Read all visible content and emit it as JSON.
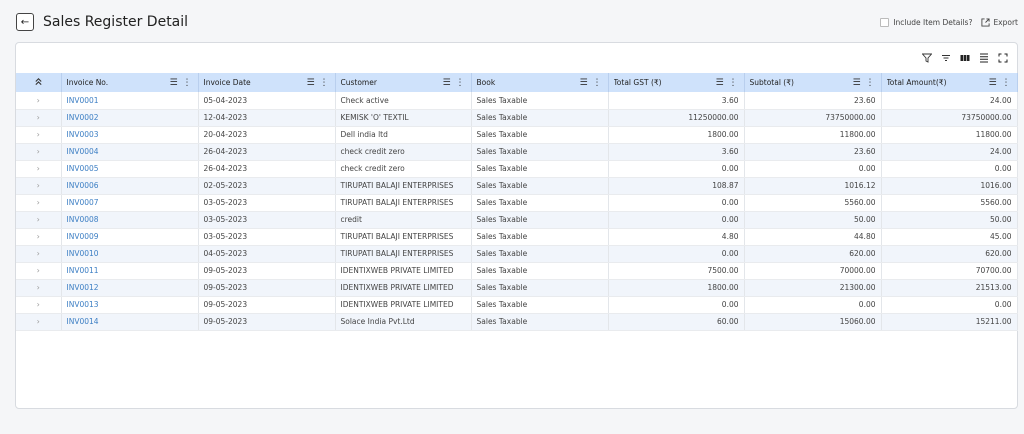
{
  "header": {
    "back_icon": "arrow-left-icon",
    "title": "Sales Register Detail",
    "include_label": "Include Item Details?",
    "export_label": "Export"
  },
  "toolbar": {
    "icons": [
      "filter-icon",
      "sort-icon",
      "columns-icon",
      "density-icon",
      "fullscreen-icon"
    ]
  },
  "table": {
    "columns": [
      "Invoice No.",
      "Invoice Date",
      "Customer",
      "Book",
      "Total GST (₹)",
      "Subtotal (₹)",
      "Total Amount(₹)"
    ],
    "rows": [
      [
        "INV0001",
        "05-04-2023",
        "Check active",
        "Sales Taxable",
        "3.60",
        "23.60",
        "24.00"
      ],
      [
        "INV0002",
        "12-04-2023",
        "KEMISK 'O' TEXTIL",
        "Sales Taxable",
        "11250000.00",
        "73750000.00",
        "73750000.00"
      ],
      [
        "INV0003",
        "20-04-2023",
        "Dell india ltd",
        "Sales Taxable",
        "1800.00",
        "11800.00",
        "11800.00"
      ],
      [
        "INV0004",
        "26-04-2023",
        "check credit zero",
        "Sales Taxable",
        "3.60",
        "23.60",
        "24.00"
      ],
      [
        "INV0005",
        "26-04-2023",
        "check credit zero",
        "Sales Taxable",
        "0.00",
        "0.00",
        "0.00"
      ],
      [
        "INV0006",
        "02-05-2023",
        "TIRUPATI BALAJI ENTERPRISES",
        "Sales Taxable",
        "108.87",
        "1016.12",
        "1016.00"
      ],
      [
        "INV0007",
        "03-05-2023",
        "TIRUPATI BALAJI ENTERPRISES",
        "Sales Taxable",
        "0.00",
        "5560.00",
        "5560.00"
      ],
      [
        "INV0008",
        "03-05-2023",
        "credit",
        "Sales Taxable",
        "0.00",
        "50.00",
        "50.00"
      ],
      [
        "INV0009",
        "03-05-2023",
        "TIRUPATI BALAJI ENTERPRISES",
        "Sales Taxable",
        "4.80",
        "44.80",
        "45.00"
      ],
      [
        "INV0010",
        "04-05-2023",
        "TIRUPATI BALAJI ENTERPRISES",
        "Sales Taxable",
        "0.00",
        "620.00",
        "620.00"
      ],
      [
        "INV0011",
        "09-05-2023",
        "IDENTIXWEB PRIVATE LIMITED",
        "Sales Taxable",
        "7500.00",
        "70000.00",
        "70700.00"
      ],
      [
        "INV0012",
        "09-05-2023",
        "IDENTIXWEB PRIVATE LIMITED",
        "Sales Taxable",
        "1800.00",
        "21300.00",
        "21513.00"
      ],
      [
        "INV0013",
        "09-05-2023",
        "IDENTIXWEB PRIVATE LIMITED",
        "Sales Taxable",
        "0.00",
        "0.00",
        "0.00"
      ],
      [
        "INV0014",
        "09-05-2023",
        "Solace India Pvt.Ltd",
        "Sales Taxable",
        "60.00",
        "15060.00",
        "15211.00"
      ]
    ]
  }
}
